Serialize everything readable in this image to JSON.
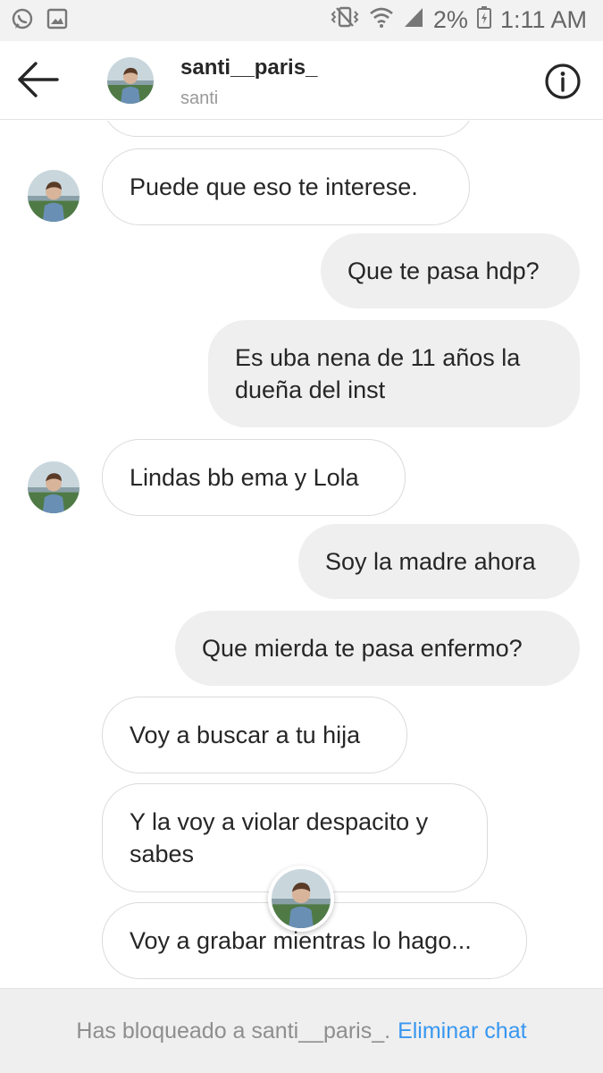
{
  "status_bar": {
    "battery": "2%",
    "time": "1:11 AM"
  },
  "header": {
    "username": "santi__paris_",
    "subtitle": "santi"
  },
  "messages": [
    {
      "direction": "in",
      "text": "Puede que eso te interese."
    },
    {
      "direction": "out",
      "text": "Que te pasa hdp?"
    },
    {
      "direction": "out",
      "text": "Es uba nena de 11 años la dueña del inst"
    },
    {
      "direction": "in",
      "text": "Lindas bb ema y Lola"
    },
    {
      "direction": "out",
      "text": "Soy la madre ahora"
    },
    {
      "direction": "out",
      "text": "Que mierda te pasa enfermo?"
    },
    {
      "direction": "in",
      "text": "Voy a buscar a tu hija"
    },
    {
      "direction": "in",
      "text": "Y la voy a violar despacito y sabes"
    },
    {
      "direction": "in",
      "text": "Voy a grabar mientras lo hago..."
    }
  ],
  "footer": {
    "blocked_text": "Has bloqueado a santi__paris_.",
    "action_label": "Eliminar chat"
  },
  "colors": {
    "link": "#3897f0",
    "outgoing_bubble": "#efefef",
    "incoming_border": "#dbdbdb",
    "footer_bg": "#efefef"
  }
}
